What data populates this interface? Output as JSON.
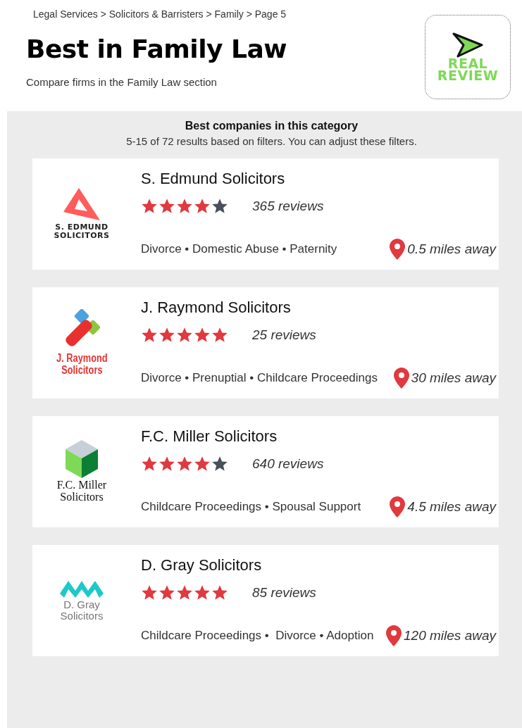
{
  "breadcrumb": "Legal Services > Solicitors & Barristers > Family > Page 5",
  "title": "Best in Family Law",
  "subtitle": "Compare firms in the Family Law section",
  "badge": {
    "lines": [
      "REAL",
      "REVIEW"
    ]
  },
  "results": {
    "heading": "Best companies in this category",
    "summary": "5-15 of 72 results based on filters. You can adjust these filters."
  },
  "firms": [
    {
      "name": "S. Edmund Solicitors",
      "stars": 4,
      "reviews": "365 reviews",
      "areas": "Divorce • Domestic Abuse • Paternity",
      "distance": "0.5 miles away",
      "logo": {
        "kind": "triangle",
        "lines": [
          "S. EDMUND",
          "SOLICITORS"
        ]
      }
    },
    {
      "name": "J. Raymond Solicitors",
      "stars": 5,
      "reviews": "25 reviews",
      "areas": "Divorce • Prenuptial • Childcare Proceedings",
      "distance": "30 miles away",
      "logo": {
        "kind": "tiles",
        "lines": [
          "J. Raymond",
          "Solicitors"
        ]
      }
    },
    {
      "name": "F.C. Miller Solicitors",
      "stars": 4,
      "reviews": "640 reviews",
      "areas": "Childcare Proceedings • Spousal Support",
      "distance": "4.5 miles away",
      "logo": {
        "kind": "cube",
        "lines": [
          "F.C. Miller",
          "Solicitors"
        ]
      }
    },
    {
      "name": "D. Gray Solicitors",
      "stars": 5,
      "reviews": "85 reviews",
      "areas": "Childcare Proceedings •  Divorce • Adoption",
      "distance": "120 miles away",
      "logo": {
        "kind": "zigzag",
        "lines": [
          "D. Gray",
          "Solicitors"
        ]
      }
    }
  ]
}
